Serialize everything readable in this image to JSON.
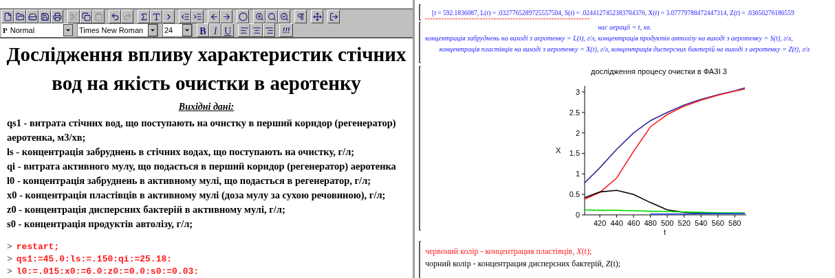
{
  "toolbar": {
    "groups": [
      [
        {
          "disabled": false
        },
        {
          "disabled": false
        },
        {
          "disabled": false
        },
        {
          "disabled": false
        },
        {
          "disabled": false
        }
      ],
      [
        {
          "disabled": true
        },
        {
          "disabled": false
        },
        {
          "disabled": true
        }
      ],
      [
        {
          "disabled": false
        },
        {
          "disabled": true
        }
      ],
      [
        {
          "disabled": false
        },
        {
          "disabled": false
        },
        {
          "disabled": false
        }
      ],
      [
        {
          "disabled": false
        },
        {
          "disabled": false
        }
      ],
      [
        {
          "disabled": false
        },
        {
          "disabled": false
        }
      ],
      [
        {
          "disabled": false
        }
      ],
      [
        {
          "disabled": false
        },
        {
          "disabled": false
        },
        {
          "disabled": false
        }
      ],
      [
        {
          "disabled": false
        }
      ],
      [
        {
          "disabled": false
        }
      ],
      [
        {
          "disabled": false
        }
      ]
    ]
  },
  "format_bar": {
    "style_marker": "P",
    "style": "Normal",
    "font": "Times New Roman",
    "size": "24",
    "text_buttons": [
      "B",
      "I",
      "U"
    ],
    "execute_button": "!!!"
  },
  "document": {
    "title": "Дослідження впливу характеристик стічних вод на якість очистки в аеротенку",
    "subtitle": "Вихідні дані:",
    "paragraphs": [
      "qs1 - витрата стічних вод, що поступають на очистку в перший коридор (регенератор) аеротенка, м3/хв;",
      "ls - концентрація забруднень в стічних водах, що поступають на очистку, г/л;",
      "qi - витрата активного мулу, що подається в перший коридор (регенератор) аеротенка",
      "l0 - концентрація забруднень в активному мулі, що подається в регенератор, г/л;",
      "x0 - концентрація пластівців в активному мулі (доза мулу за сухою речовиною), г/л;",
      "z0 - концентрація дисперсних бактерій в активному мулі, г/л;",
      "s0 - концентрація продуктів автолізу, г/л;"
    ],
    "commands": [
      {
        "prompt": ">",
        "code": "restart;"
      },
      {
        "prompt": ">",
        "code": "qs1:=45.0:ls:=.150:qi:=25.18:"
      },
      {
        "prompt": ">",
        "code": "l0:=.015:x0:=6.0:z0:=0.0:s0:=0.03:"
      }
    ]
  },
  "output": {
    "result": "[*t* = 592.1836087, L(*t*) = .0327765289725557504, S(*t*) = .0244127452383704376, X(*t*) = 3.07779788472447314, Z(*t*) = .03650276186559",
    "captions": [
      "час аерації = t, хв.",
      "концентрація забруднень на виході з аеротенку = L(t), г/л, концентрація продуктів автолізу на виході з аеротенку = S(t), г/л,",
      "концентрація пластівців на виході з аеротенку = X(t), г/л, концентрація дисперсних бактерій на виході з аеротенку = Z(t), г/л"
    ],
    "chart_data": {
      "type": "line",
      "title": "дослідження процесу очистки в ФАЗІ 3",
      "xlabel": "t",
      "ylabel": "X",
      "x": [
        402,
        420,
        440,
        460,
        480,
        500,
        520,
        540,
        560,
        580,
        592
      ],
      "series": [
        {
          "color": "#2a2a9a",
          "values": [
            0.78,
            1.15,
            1.6,
            2.0,
            2.3,
            2.5,
            2.68,
            2.82,
            2.93,
            3.03,
            3.1
          ]
        },
        {
          "color": "#ff2020",
          "values": [
            0.38,
            0.55,
            0.9,
            1.55,
            2.15,
            2.45,
            2.65,
            2.8,
            2.92,
            3.02,
            3.07
          ]
        },
        {
          "color": "#000000",
          "values": [
            0.42,
            0.56,
            0.6,
            0.5,
            0.3,
            0.12,
            0.06,
            0.04,
            0.04,
            0.03,
            0.03
          ]
        },
        {
          "color": "#00dd00",
          "values": [
            0.12,
            0.11,
            0.11,
            0.1,
            0.09,
            0.08,
            0.07,
            0.06,
            0.05,
            0.05,
            0.05
          ]
        },
        {
          "color": "#1a40ff",
          "values": [
            null,
            null,
            null,
            null,
            0.02,
            0.02,
            0.02,
            0.03,
            0.03,
            0.03,
            0.03
          ]
        }
      ],
      "xlim": [
        402,
        592
      ],
      "ylim": [
        0,
        3.15
      ],
      "xticks": [
        420,
        440,
        460,
        480,
        500,
        520,
        540,
        560,
        580
      ],
      "yticks": [
        0,
        {
          "value": 0.5,
          "label": "0.5"
        },
        1,
        {
          "value": 1.5,
          "label": "1.5"
        },
        2,
        {
          "value": 2.5,
          "label": "2.5"
        },
        3
      ]
    },
    "legend": [
      {
        "text": "червоний колір - концентрация пластівців, *X*(t);",
        "color": "#ff2020"
      },
      {
        "text": "чорний колір - концентрация дисперсних бактерій, *Z*(t);",
        "color": "#000000"
      }
    ]
  }
}
